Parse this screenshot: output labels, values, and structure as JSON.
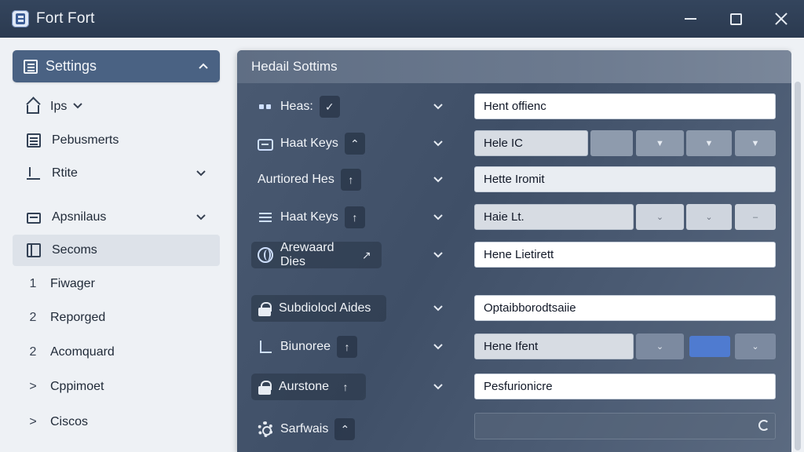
{
  "window": {
    "title": "Fort Fort"
  },
  "sidebar": {
    "header": {
      "label": "Settings",
      "icon": "settings-icon"
    },
    "items": [
      {
        "label": "Ips",
        "icon": "home-icon"
      },
      {
        "label": "Pebusmerts",
        "icon": "grid-icon"
      },
      {
        "label": "Rtite",
        "icon": "sort-icon"
      },
      {
        "label": "Apsnilaus",
        "icon": "list-icon"
      },
      {
        "label": "Secoms",
        "icon": "book-icon"
      },
      {
        "label": "Fiwager",
        "number": "1"
      },
      {
        "label": "Reporged",
        "number": "2"
      },
      {
        "label": "Acomquard",
        "number": "2"
      },
      {
        "label": "Cppimoet",
        "marker": ">"
      },
      {
        "label": "Ciscos",
        "marker": ">"
      }
    ]
  },
  "panel": {
    "title": "Hedail Sottims",
    "rows": [
      {
        "label": "Heas:",
        "badge": "✓",
        "value": "Hent offienc",
        "icon": "dots-icon"
      },
      {
        "label": "Haat Keys",
        "badge": "⌃",
        "value": "Hele IC",
        "icon": "keyboard-icon"
      },
      {
        "label": "Aurtiored Hes",
        "badge": "↑",
        "value": "Hette Iromit",
        "icon": "none"
      },
      {
        "label": "Haat Keys",
        "badge": "↑",
        "value": "Haie Lt.",
        "icon": "lines-icon"
      },
      {
        "label": "Arewaard Dies",
        "badge": "↗",
        "value": "Hene Lietirett",
        "icon": "globe-icon"
      },
      {
        "label": "Subdiolocl Aides",
        "badge": "",
        "value": "Optaibborodtsaiie",
        "icon": "lock-icon"
      },
      {
        "label": "Biunoree",
        "badge": "↑",
        "value": "Hene Ifent",
        "icon": "chart-icon"
      },
      {
        "label": "Aurstone",
        "badge": "↑",
        "value": "Pesfurionicre",
        "icon": "lock-icon"
      },
      {
        "label": "Sarfwais",
        "badge": "⌃",
        "value": "",
        "icon": "gear-icon"
      }
    ]
  },
  "colors": {
    "titlebar": "#2f3f56",
    "sidebar_active": "#4a6283",
    "panel": "#45556d",
    "accent": "#4f7bd0"
  }
}
